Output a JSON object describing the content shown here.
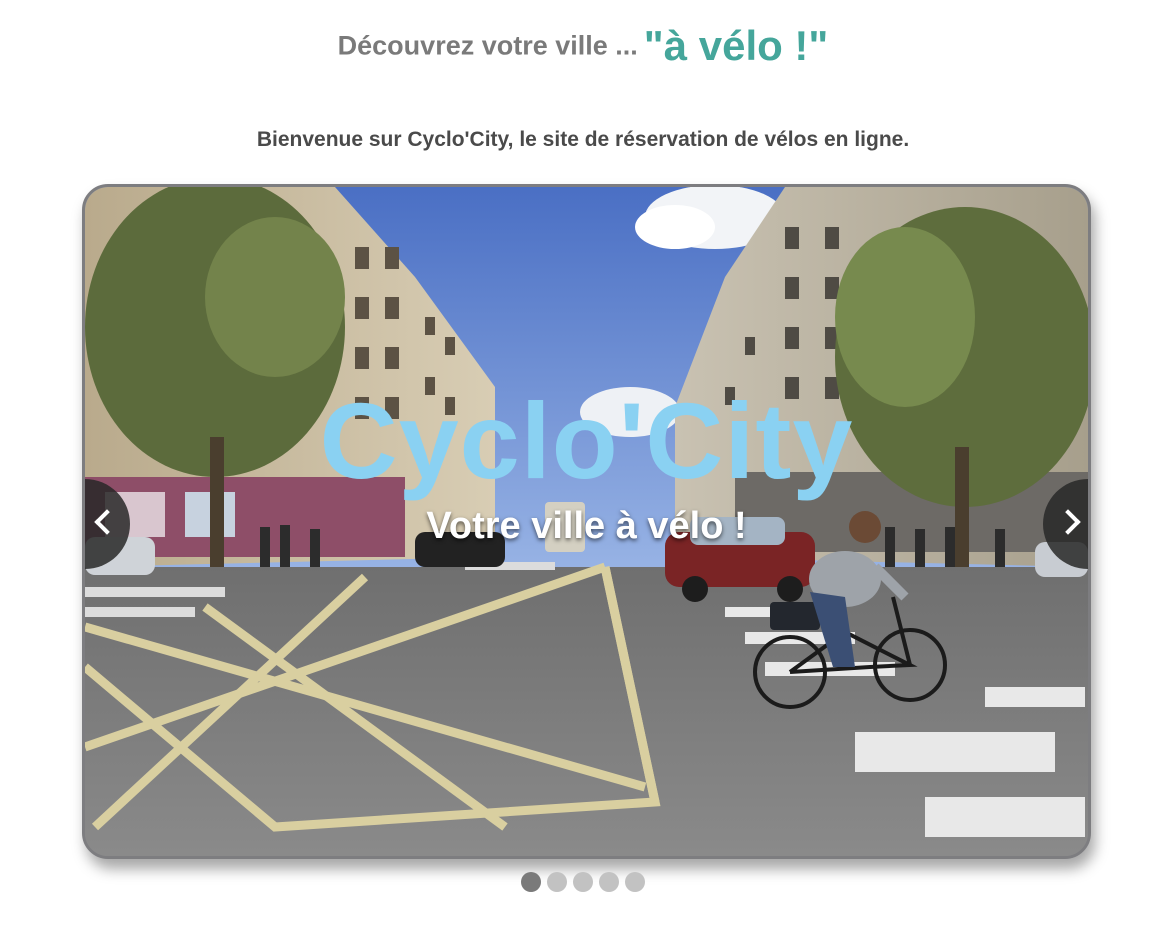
{
  "header": {
    "lead_text": "Découvrez votre ville ...",
    "accent_text": "\"à vélo !\"",
    "accent_color": "#45a69b"
  },
  "welcome_text": "Bienvenue sur Cyclo'City, le site de réservation de vélos en ligne.",
  "slider": {
    "title": "Cyclo'City",
    "subtitle": "Votre ville à vélo !",
    "title_color": "#8ad1f2",
    "prev_icon": "chevron-left-icon",
    "next_icon": "chevron-right-icon",
    "slide_count": 5,
    "active_index": 0
  }
}
